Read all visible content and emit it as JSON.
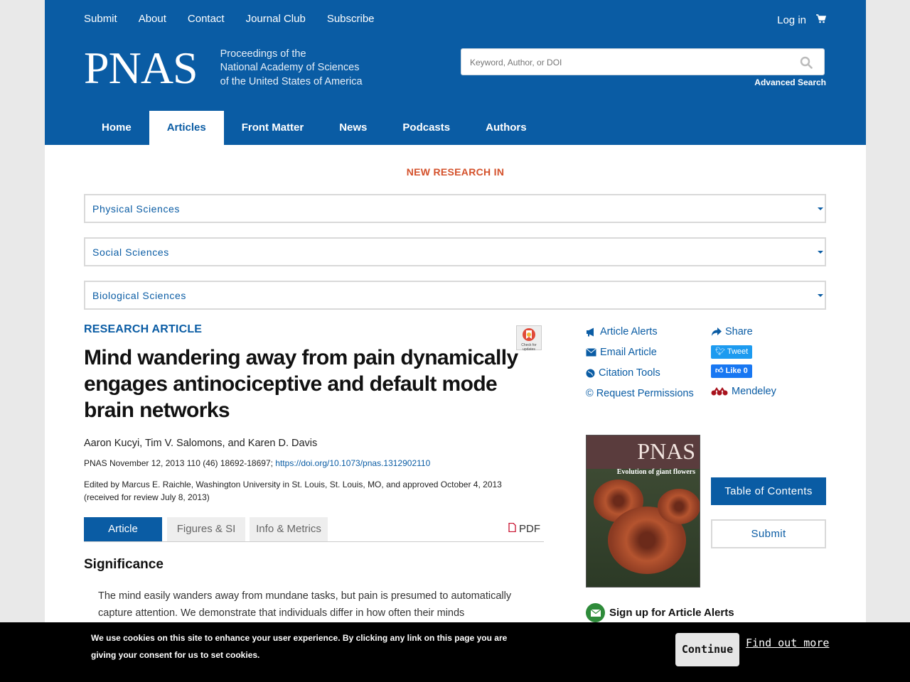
{
  "header": {
    "topnav": [
      "Submit",
      "About",
      "Contact",
      "Journal Club",
      "Subscribe"
    ],
    "login": "Log in",
    "logo": "PNAS",
    "logo_sub": [
      "Proceedings of the",
      "National Academy of Sciences",
      "of the United States of America"
    ],
    "search_placeholder": "Keyword, Author, or DOI",
    "advanced_search": "Advanced Search",
    "mainnav": [
      "Home",
      "Articles",
      "Front Matter",
      "News",
      "Podcasts",
      "Authors"
    ],
    "active_nav": "Articles"
  },
  "new_research": {
    "heading": "NEW RESEARCH IN",
    "dropdowns": [
      "Physical Sciences",
      "Social Sciences",
      "Biological Sciences"
    ]
  },
  "article": {
    "kicker": "RESEARCH ARTICLE",
    "badge_text": "Check for updates",
    "title": "Mind wandering away from pain dynamically engages antinociceptive and default mode brain networks",
    "authors": "Aaron Kucyi, Tim V. Salomons, and Karen D. Davis",
    "citation": "PNAS November 12, 2013 110 (46) 18692-18697; ",
    "doi": "https://doi.org/10.1073/pnas.1312902110",
    "edited": "Edited by Marcus E. Raichle, Washington University in St. Louis, St. Louis, MO, and approved October 4, 2013 (received for review July 8, 2013)",
    "tabs": [
      "Article",
      "Figures & SI",
      "Info & Metrics"
    ],
    "pdf": "PDF",
    "section_heading": "Significance",
    "abstract_line1": "The mind easily wanders away from mundane tasks, but pain is presumed to automatically",
    "abstract_line2": "capture attention. We demonstrate that individuals differ in how often their minds"
  },
  "sidebar": {
    "tools": [
      "Article Alerts",
      "Email Article",
      "Citation Tools",
      "© Request Permissions"
    ],
    "share": "Share",
    "tweet": "Tweet",
    "like": "Like 0",
    "mendeley": "Mendeley",
    "cover_title": "PNAS",
    "cover_subtitle": "Evolution of giant flowers",
    "toc_button": "Table of Contents",
    "submit_button": "Submit",
    "signup": "Sign up for Article Alerts"
  },
  "cookie": {
    "text": "We use cookies on this site to enhance your user experience. By clicking any link on this page you are giving your consent for us to set cookies.",
    "continue": "Continue",
    "find_out_more": "Find out more"
  },
  "colors": {
    "brand_blue": "#0a5ca4",
    "accent_orange": "#d4512b"
  }
}
